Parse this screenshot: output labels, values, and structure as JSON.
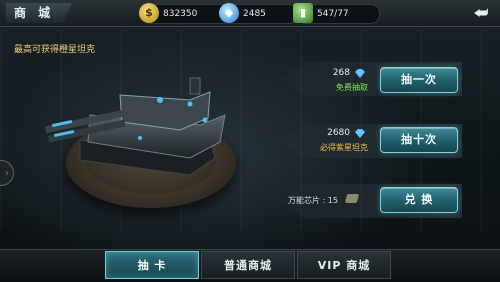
{
  "header": {
    "title": "商 城",
    "gold": "832350",
    "gems": "2485",
    "fuel": "547/77"
  },
  "promo": {
    "hint": "最高可获得橙星坦克"
  },
  "draw_one": {
    "cost": "268",
    "note": "免费抽取",
    "label": "抽一次"
  },
  "draw_ten": {
    "cost": "2680",
    "note": "必得紫星坦克",
    "label": "抽十次"
  },
  "exchange": {
    "chips_label": "万能芯片 :",
    "chips_count": "15",
    "label": "兑 换"
  },
  "tabs": [
    {
      "label": "抽 卡"
    },
    {
      "label": "普通商城"
    },
    {
      "label": "VIP 商城"
    }
  ],
  "colors": {
    "accent": "#3f8a96",
    "gold_text": "#f0c04a",
    "free_text": "#8be35a"
  }
}
